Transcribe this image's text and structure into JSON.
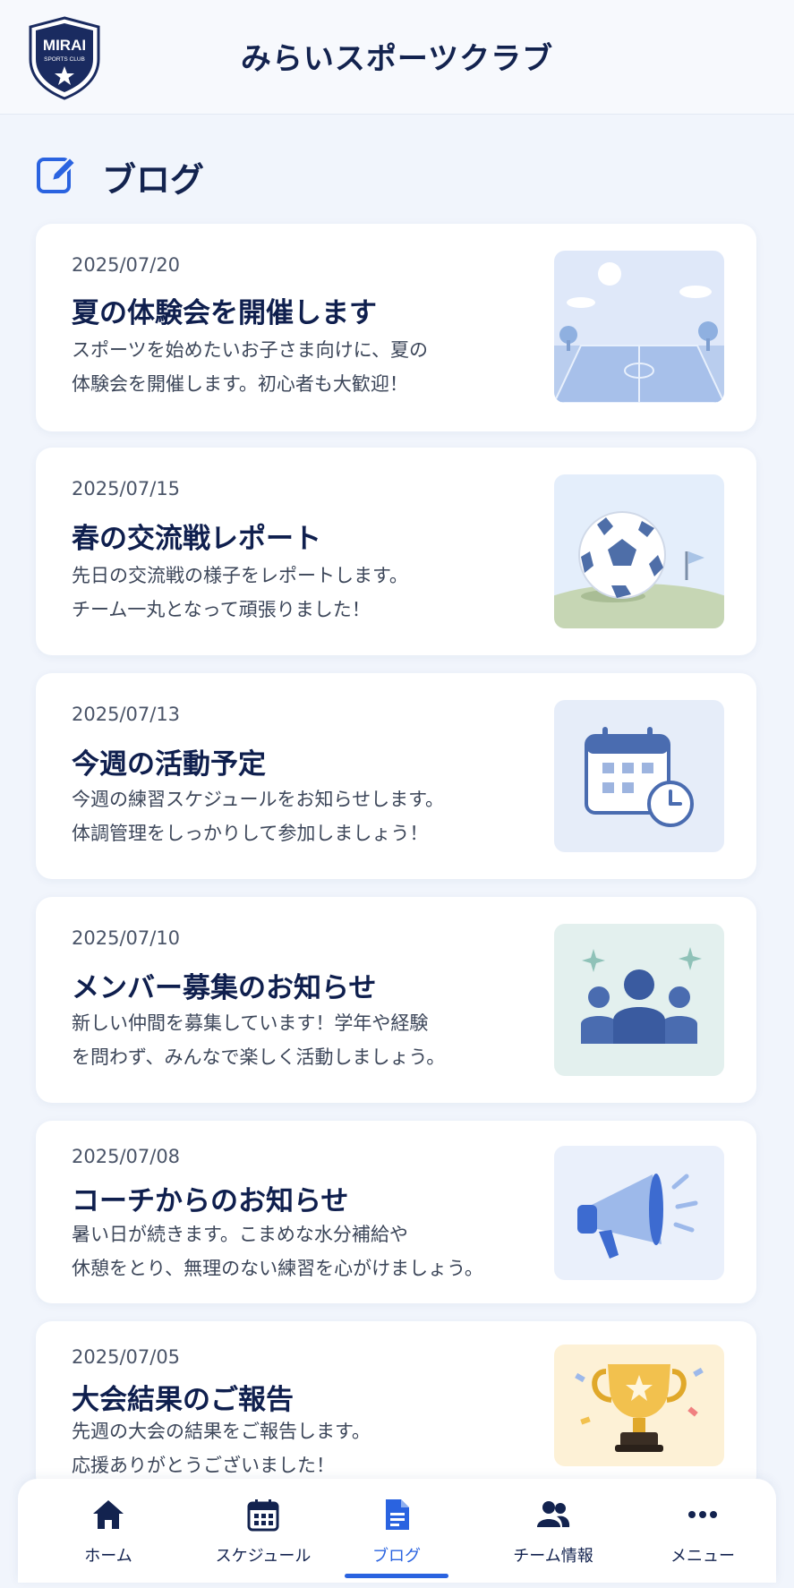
{
  "header": {
    "title": "みらいスポーツクラブ",
    "logo_text": "MIRAI",
    "logo_sub": "SPORTS CLUB"
  },
  "section": {
    "title": "ブログ",
    "icon": "edit-icon"
  },
  "posts": [
    {
      "date": "2025/07/20",
      "title": "夏の体験会を開催します",
      "body": [
        "スポーツを始めたいお子さま向けに、夏の",
        "体験会を開催します。初心者も大歓迎！"
      ],
      "thumbnail": "sports-field-image"
    },
    {
      "date": "2025/07/15",
      "title": "春の交流戦レポート",
      "body": [
        "先日の交流戦の様子をレポートします。",
        "チーム一丸となって頑張りました！"
      ],
      "thumbnail": "soccer-ball-image"
    },
    {
      "date": "2025/07/13",
      "title": "今週の活動予定",
      "body": [
        "今週の練習スケジュールをお知らせします。",
        "体調管理をしっかりして参加しましょう！"
      ],
      "thumbnail": "calendar-clock-image"
    },
    {
      "date": "2025/07/10",
      "title": "メンバー募集のお知らせ",
      "body": [
        "新しい仲間を募集しています！学年や経験",
        "を問わず、みんなで楽しく活動しましょう。"
      ],
      "thumbnail": "group-people-image"
    },
    {
      "date": "2025/07/08",
      "title": "コーチからのお知らせ",
      "body": [
        "暑い日が続きます。こまめな水分補給や",
        "休憩をとり、無理のない練習を心がけましょう。"
      ],
      "thumbnail": "megaphone-image"
    },
    {
      "date": "2025/07/05",
      "title": "大会結果のご報告",
      "body": [
        "先週の大会の結果をご報告します。",
        "応援ありがとうございました！"
      ],
      "thumbnail": "trophy-image"
    }
  ],
  "tabbar": {
    "active": "ブログ",
    "items": [
      {
        "label": "ホーム",
        "icon": "home-icon"
      },
      {
        "label": "スケジュール",
        "icon": "calendar-icon"
      },
      {
        "label": "ブログ",
        "icon": "document-icon"
      },
      {
        "label": "チーム情報",
        "icon": "team-icon"
      },
      {
        "label": "メニュー",
        "icon": "more-icon"
      }
    ]
  },
  "colors": {
    "primary": "#13234f",
    "accent": "#2a63e0",
    "background": "#f1f5fc"
  }
}
